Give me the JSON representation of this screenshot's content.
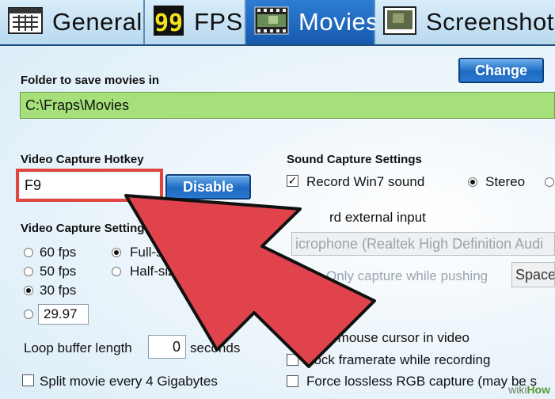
{
  "tabs": [
    {
      "label": "General",
      "icon": "grid-window-icon",
      "active": false
    },
    {
      "label": "FPS",
      "icon": "fps-99-icon",
      "badge": "99",
      "active": false
    },
    {
      "label": "Movies",
      "icon": "film-strip-icon",
      "active": true
    },
    {
      "label": "Screenshots",
      "icon": "photo-icon",
      "active": false
    }
  ],
  "movies": {
    "folder_label": "Folder to save movies in",
    "change_button": "Change",
    "folder_path": "C:\\Fraps\\Movies",
    "hotkey_label": "Video Capture Hotkey",
    "hotkey_value": "F9",
    "disable_button": "Disable",
    "video_settings_label": "Video Capture Settin",
    "video_settings_tail": "gs",
    "fps_options": [
      {
        "label": "60 fps",
        "selected": false
      },
      {
        "label": "50 fps",
        "selected": false
      },
      {
        "label": "30 fps",
        "selected": true
      }
    ],
    "custom_fps_value": "29.97",
    "size_options": [
      {
        "label": "Full-siz",
        "selected": true
      },
      {
        "label": "Half-size",
        "selected": false
      }
    ],
    "loop_buffer_label": "Loop buffer length",
    "loop_buffer_value": "0",
    "loop_buffer_unit": "seconds",
    "split_movie_label": "Split movie every 4 Gigabytes",
    "split_movie_checked": false
  },
  "sound": {
    "title": "Sound Capture Settings",
    "record_win7_label": "Record Win7 sound",
    "record_win7_checked": true,
    "stereo_label": "Stereo",
    "stereo_selected": true,
    "record_external_label": "rd external input",
    "device_value": "icrophone (Realtek High Definition Audi",
    "only_capture_label": "Only capture while pushing",
    "push_key_value": "Space"
  },
  "options": [
    {
      "label": "Hide mouse cursor in video",
      "checked": false
    },
    {
      "label": "Lock framerate while recording",
      "checked": false
    },
    {
      "label": "Force lossless RGB capture (may be s",
      "checked": false
    }
  ],
  "watermark": {
    "prefix": "wiki",
    "suffix": "How"
  },
  "colors": {
    "tab_active": "#1659ad",
    "folder_field_bg": "#a6e07a",
    "hotkey_highlight": "#e0463f",
    "arrow_fill": "#e0434b",
    "button_blue": "#1e6ac2"
  }
}
